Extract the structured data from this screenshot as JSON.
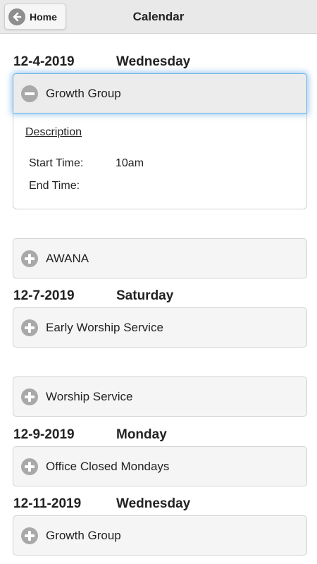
{
  "header": {
    "home_label": "Home",
    "title": "Calendar"
  },
  "groups": [
    {
      "date": "12-4-2019",
      "day": "Wednesday"
    },
    {
      "date": "12-7-2019",
      "day": "Saturday"
    },
    {
      "date": "12-9-2019",
      "day": "Monday"
    },
    {
      "date": "12-11-2019",
      "day": "Wednesday"
    }
  ],
  "events": [
    {
      "name": "Growth Group",
      "state": "expanded",
      "icon": "minus-circle-icon"
    },
    {
      "name": "AWANA",
      "state": "collapsed",
      "icon": "plus-circle-icon"
    },
    {
      "name": "Early Worship Service",
      "state": "collapsed",
      "icon": "plus-circle-icon"
    },
    {
      "name": "Worship Service",
      "state": "collapsed",
      "icon": "plus-circle-icon"
    },
    {
      "name": "Office Closed Mondays",
      "state": "collapsed",
      "icon": "plus-circle-icon"
    },
    {
      "name": "Growth Group",
      "state": "collapsed",
      "icon": "plus-circle-icon"
    }
  ],
  "details": {
    "description_label": "Description",
    "start_label": "Start Time:",
    "start_value": "10am",
    "end_label": "End Time:",
    "end_value": ""
  },
  "colors": {
    "header_bg": "#e9e9e9",
    "focus_glow": "#6fb3e6",
    "icon_gray": "#a9a9a9"
  }
}
